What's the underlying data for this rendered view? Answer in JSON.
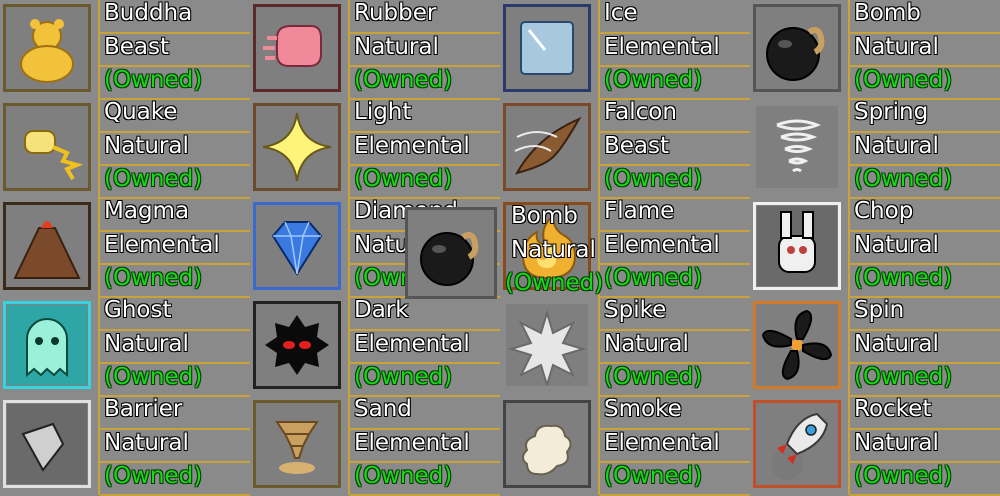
{
  "columns": [
    {
      "cards": [
        {
          "name": "Buddha",
          "type": "Beast",
          "status": "(Owned)",
          "icon": "buddha-icon",
          "border": "#6b5a2e"
        },
        {
          "name": "Quake",
          "type": "Natural",
          "status": "(Owned)",
          "icon": "quake-fist-icon",
          "border": "#6b5a2e"
        },
        {
          "name": "Magma",
          "type": "Elemental",
          "status": "(Owned)",
          "icon": "volcano-icon",
          "border": "#3a2a1a"
        },
        {
          "name": "Ghost",
          "type": "Natural",
          "status": "(Owned)",
          "icon": "ghost-icon",
          "border": "#35d4e0"
        },
        {
          "name": "Barrier",
          "type": "Natural",
          "status": "(Owned)",
          "icon": "barrier-icon",
          "border": "#e0e0e0"
        }
      ]
    },
    {
      "cards": [
        {
          "name": "Rubber",
          "type": "Natural",
          "status": "(Owned)",
          "icon": "rubber-fist-icon",
          "border": "#5a2a2a"
        },
        {
          "name": "Light",
          "type": "Elemental",
          "status": "(Owned)",
          "icon": "star-sparkle-icon",
          "border": "#6b4a2e"
        },
        {
          "name": "Diamond",
          "type": "Natural",
          "status": "(Owned)",
          "icon": "diamond-icon",
          "border": "#3a6ad0"
        },
        {
          "name": "Dark",
          "type": "Elemental",
          "status": "(Owned)",
          "icon": "dark-blob-icon",
          "border": "#222222"
        },
        {
          "name": "Sand",
          "type": "Elemental",
          "status": "(Owned)",
          "icon": "sand-tornado-icon",
          "border": "#6b5a2e"
        }
      ]
    },
    {
      "cards": [
        {
          "name": "Ice",
          "type": "Elemental",
          "status": "(Owned)",
          "icon": "ice-cube-icon",
          "border": "#2a3a6a"
        },
        {
          "name": "Falcon",
          "type": "Beast",
          "status": "(Owned)",
          "icon": "wing-icon",
          "border": "#7a4a2a"
        },
        {
          "name": "Flame",
          "type": "Elemental",
          "status": "(Owned)",
          "icon": "flame-icon",
          "border": "#8a4a1a"
        },
        {
          "name": "Spike",
          "type": "Natural",
          "status": "(Owned)",
          "icon": "spike-burst-icon",
          "border": "#8a8a8a"
        },
        {
          "name": "Smoke",
          "type": "Elemental",
          "status": "(Owned)",
          "icon": "smoke-icon",
          "border": "#444444"
        }
      ]
    },
    {
      "cards": [
        {
          "name": "Bomb",
          "type": "Natural",
          "status": "(Owned)",
          "icon": "bomb-icon",
          "border": "#555555"
        },
        {
          "name": "Spring",
          "type": "Natural",
          "status": "(Owned)",
          "icon": "spring-icon",
          "border": "#8a8a8a"
        },
        {
          "name": "Chop",
          "type": "Natural",
          "status": "(Owned)",
          "icon": "chop-hand-icon",
          "border": "#f0f0f0"
        },
        {
          "name": "Spin",
          "type": "Natural",
          "status": "(Owned)",
          "icon": "propeller-icon",
          "border": "#d07a2a"
        },
        {
          "name": "Rocket",
          "type": "Natural",
          "status": "(Owned)",
          "icon": "rocket-icon",
          "border": "#c0502a"
        }
      ]
    }
  ],
  "drag_preview": {
    "name": "Bomb",
    "type": "Natural",
    "status": "(Owned)",
    "icon": "bomb-icon"
  }
}
